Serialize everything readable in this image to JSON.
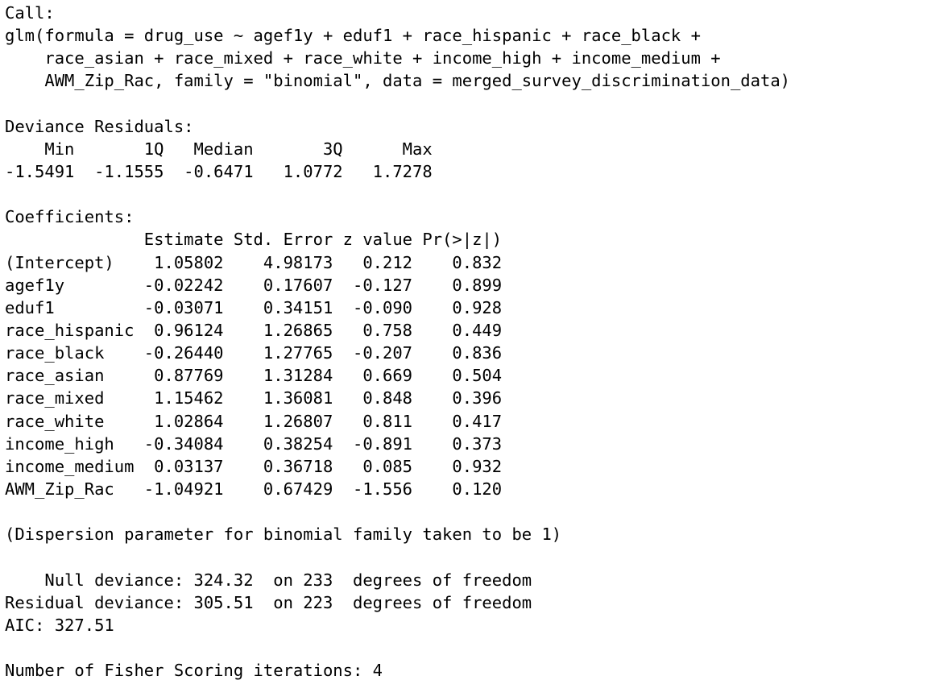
{
  "console": {
    "call_header": "Call:",
    "call_lines": [
      "glm(formula = drug_use ~ agef1y + eduf1 + race_hispanic + race_black + ",
      "    race_asian + race_mixed + race_white + income_high + income_medium + ",
      "    AWM_Zip_Rac, family = \"binomial\", data = merged_survey_discrimination_data)"
    ],
    "deviance_residuals": {
      "title": "Deviance Residuals: ",
      "header_line": "    Min       1Q   Median       3Q      Max  ",
      "values_line": "-1.5491  -1.1555  -0.6471   1.0772   1.7278  "
    },
    "coefficients": {
      "title": "Coefficients:",
      "header_line": "              Estimate Std. Error z value Pr(>|z|)",
      "rows": [
        "(Intercept)    1.05802    4.98173   0.212    0.832",
        "agef1y        -0.02242    0.17607  -0.127    0.899",
        "eduf1         -0.03071    0.34151  -0.090    0.928",
        "race_hispanic  0.96124    1.26865   0.758    0.449",
        "race_black    -0.26440    1.27765  -0.207    0.836",
        "race_asian     0.87769    1.31284   0.669    0.504",
        "race_mixed     1.15462    1.36081   0.848    0.396",
        "race_white     1.02864    1.26807   0.811    0.417",
        "income_high   -0.34084    0.38254  -0.891    0.373",
        "income_medium  0.03137    0.36718   0.085    0.932",
        "AWM_Zip_Rac   -1.04921    0.67429  -1.556    0.120"
      ]
    },
    "dispersion_note": "(Dispersion parameter for binomial family taken to be 1)",
    "null_deviance": "    Null deviance: 324.32  on 233  degrees of freedom",
    "residual_deviance": "Residual deviance: 305.51  on 223  degrees of freedom",
    "aic": "AIC: 327.51",
    "fisher_iterations": "Number of Fisher Scoring iterations: 4"
  },
  "colors": {
    "background": "#ffffff",
    "text": "#000000"
  }
}
